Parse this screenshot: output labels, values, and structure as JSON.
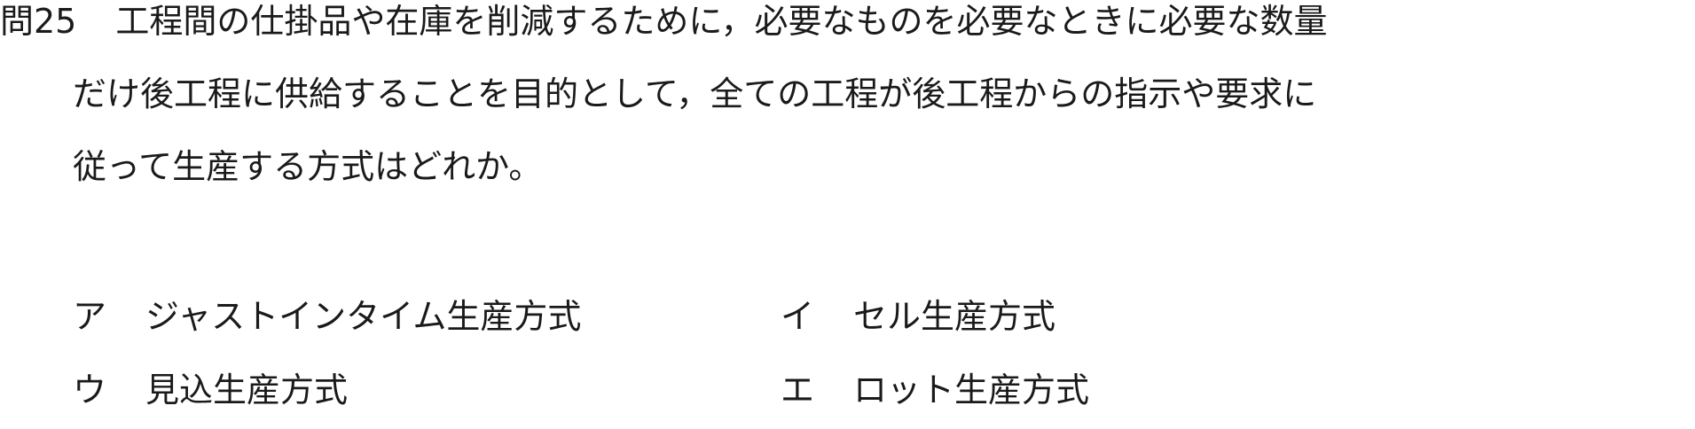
{
  "question": {
    "number": "問25",
    "line1": "工程間の仕掛品や在庫を削減するために，必要なものを必要なときに必要な数量",
    "line2": "だけ後工程に供給することを目的として，全ての工程が後工程からの指示や要求に",
    "line3": "従って生産する方式はどれか。"
  },
  "choices": {
    "a": {
      "key": "ア",
      "text": "ジャストインタイム生産方式"
    },
    "i": {
      "key": "イ",
      "text": "セル生産方式"
    },
    "u": {
      "key": "ウ",
      "text": "見込生産方式"
    },
    "e": {
      "key": "エ",
      "text": "ロット生産方式"
    }
  }
}
